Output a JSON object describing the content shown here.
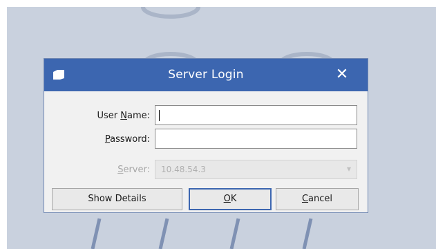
{
  "dialog": {
    "title": "Server Login",
    "close_label": "✕"
  },
  "form": {
    "username_label": "User Name:",
    "username_value": "",
    "password_label": "Password:",
    "password_value": "",
    "server_label": "Server:",
    "server_value": "10.48.54.3"
  },
  "buttons": {
    "details_label": "Show Details",
    "ok_label": "OK",
    "cancel_label": "Cancel"
  },
  "colors": {
    "titlebar": "#3c66b0",
    "background": "#c9d1de",
    "dialog_body": "#f1f1f1"
  },
  "icons": {
    "app": "folder-icon",
    "close": "close-icon",
    "dropdown": "chevron-down-icon"
  }
}
